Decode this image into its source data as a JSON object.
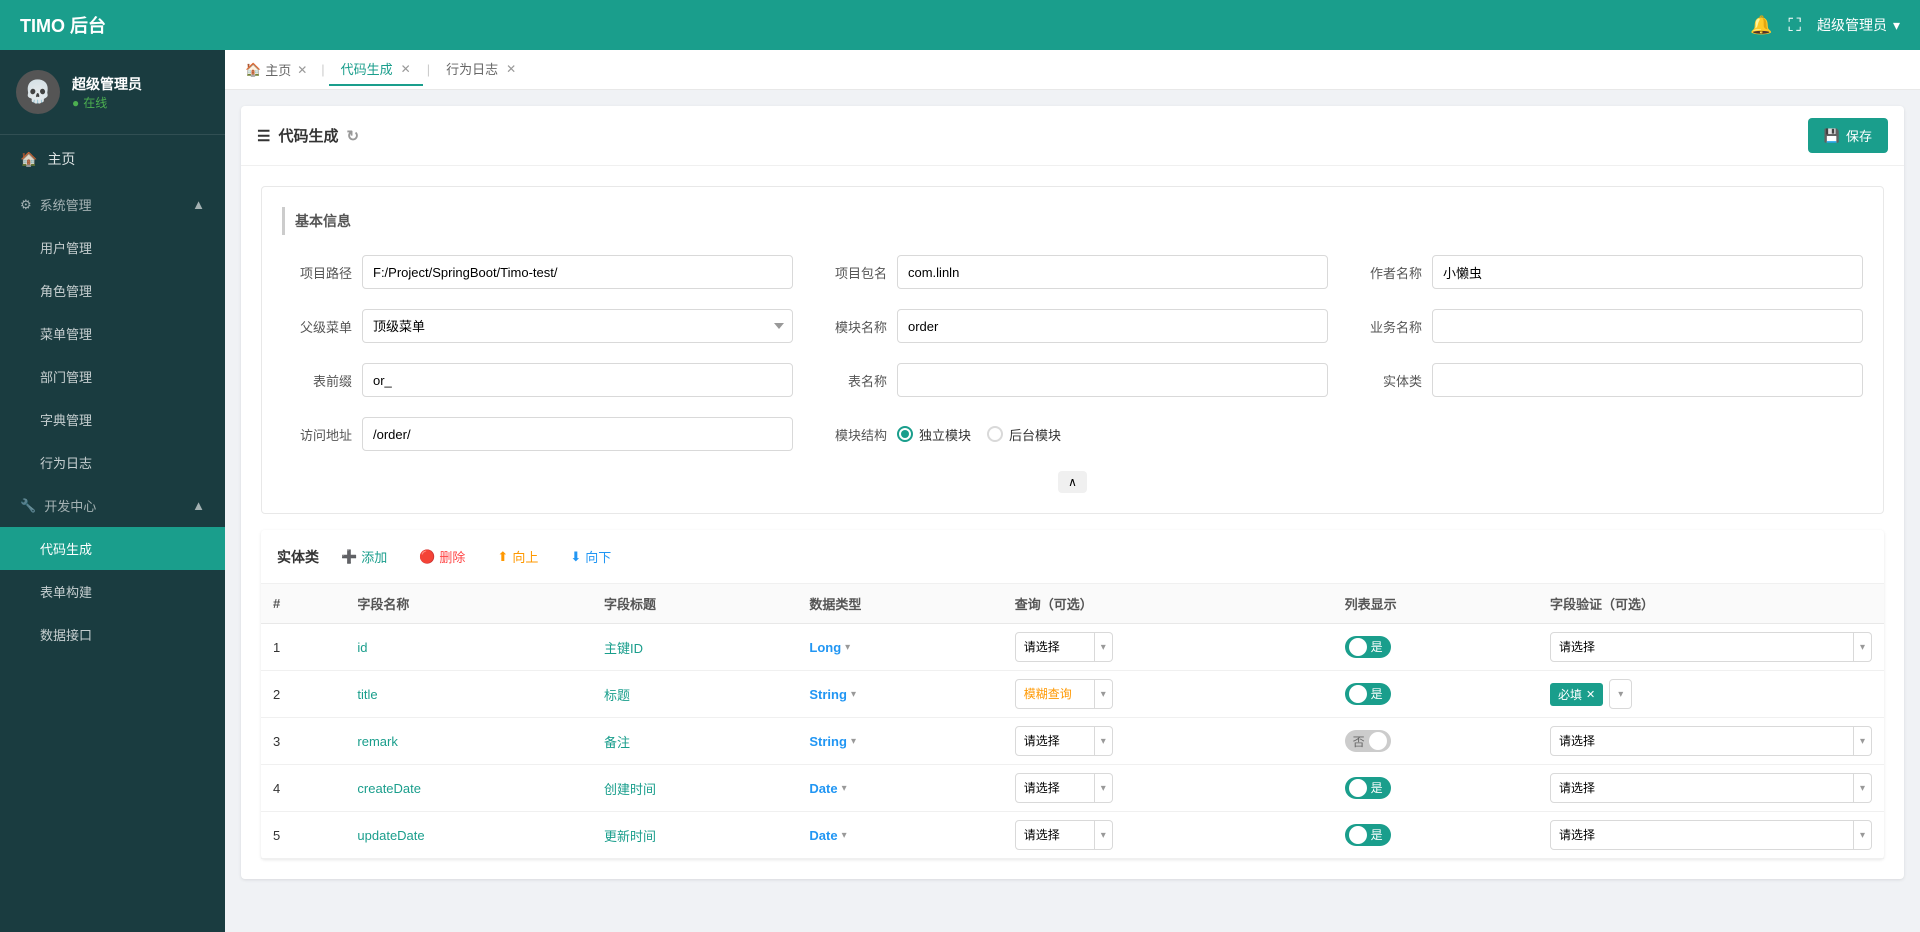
{
  "app": {
    "title": "TIMO 后台"
  },
  "topnav": {
    "title": "TIMO 后台",
    "user": "超级管理员",
    "bell_icon": "🔔",
    "expand_icon": "⛶",
    "arrow_icon": "▾"
  },
  "sidebar": {
    "username": "超级管理员",
    "status": "在线",
    "home_label": "主页",
    "system_label": "系统管理",
    "user_mgmt": "用户管理",
    "role_mgmt": "角色管理",
    "menu_mgmt": "菜单管理",
    "dept_mgmt": "部门管理",
    "dict_mgmt": "字典管理",
    "activity_log": "行为日志",
    "dev_center": "开发中心",
    "code_gen": "代码生成",
    "form_builder": "表单构建",
    "data_api": "数据接口"
  },
  "tabs": [
    {
      "label": "主页",
      "active": false,
      "closeable": true,
      "icon": "🏠"
    },
    {
      "label": "代码生成",
      "active": true,
      "closeable": true
    },
    {
      "label": "行为日志",
      "active": false,
      "closeable": true
    }
  ],
  "page": {
    "title": "代码生成",
    "save_button": "保存",
    "section_basic": "基本信息",
    "collapse_icon": "∧"
  },
  "form": {
    "project_path_label": "项目路径",
    "project_path_value": "F:/Project/SpringBoot/Timo-test/",
    "package_name_label": "项目包名",
    "package_name_value": "com.linln",
    "author_label": "作者名称",
    "author_value": "小懒虫",
    "parent_menu_label": "父级菜单",
    "parent_menu_value": "顶级菜单",
    "module_name_label": "模块名称",
    "module_name_value": "order",
    "biz_name_label": "业务名称",
    "biz_name_value": "",
    "table_prefix_label": "表前缀",
    "table_prefix_value": "or_",
    "table_name_label": "表名称",
    "table_name_value": "",
    "entity_class_label": "实体类",
    "entity_class_value": "",
    "access_url_label": "访问地址",
    "access_url_value": "/order/",
    "module_structure_label": "模块结构",
    "module_standalone": "独立模块",
    "module_backend": "后台模块",
    "parent_menu_options": [
      "顶级菜单"
    ]
  },
  "entity_table": {
    "title": "实体类",
    "add_label": "添加",
    "delete_label": "删除",
    "up_label": "向上",
    "down_label": "向下",
    "columns": {
      "num": "#",
      "field_name": "字段名称",
      "field_label": "字段标题",
      "data_type": "数据类型",
      "query": "查询（可选）",
      "list_display": "列表显示",
      "validation": "字段验证（可选）"
    },
    "rows": [
      {
        "num": "1",
        "field_name": "id",
        "field_label": "主键ID",
        "data_type": "Long",
        "query_value": "请选择",
        "list_display": "yes",
        "validation_value": "请选择",
        "validation_badge": null
      },
      {
        "num": "2",
        "field_name": "title",
        "field_label": "标题",
        "data_type": "String",
        "query_value": "模糊查询",
        "query_type": "fuzzy",
        "list_display": "yes",
        "validation_value": "",
        "validation_badge": "必填"
      },
      {
        "num": "3",
        "field_name": "remark",
        "field_label": "备注",
        "data_type": "String",
        "query_value": "请选择",
        "list_display": "no",
        "validation_value": "请选择",
        "validation_badge": null
      },
      {
        "num": "4",
        "field_name": "createDate",
        "field_label": "创建时间",
        "data_type": "Date",
        "query_value": "请选择",
        "list_display": "yes",
        "validation_value": "请选择",
        "validation_badge": null
      },
      {
        "num": "5",
        "field_name": "updateDate",
        "field_label": "更新时间",
        "data_type": "Date",
        "query_value": "请选择",
        "list_display": "yes",
        "validation_value": "请选择",
        "validation_badge": null
      }
    ]
  }
}
